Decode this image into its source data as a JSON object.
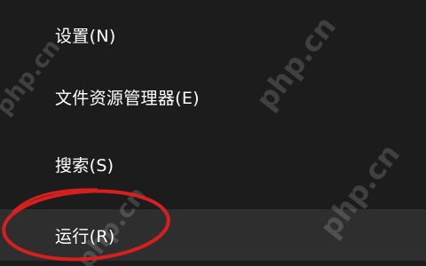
{
  "menu": {
    "items": [
      {
        "label": "设置(N)"
      },
      {
        "label": "文件资源管理器(E)"
      },
      {
        "label": "搜索(S)"
      },
      {
        "label": "运行(R)"
      }
    ]
  },
  "watermark": "php.cn",
  "colors": {
    "background": "#1c1c1c",
    "highlight": "#2e2e2e",
    "annotation_circle": "#d61f1f",
    "text": "#ffffff"
  }
}
